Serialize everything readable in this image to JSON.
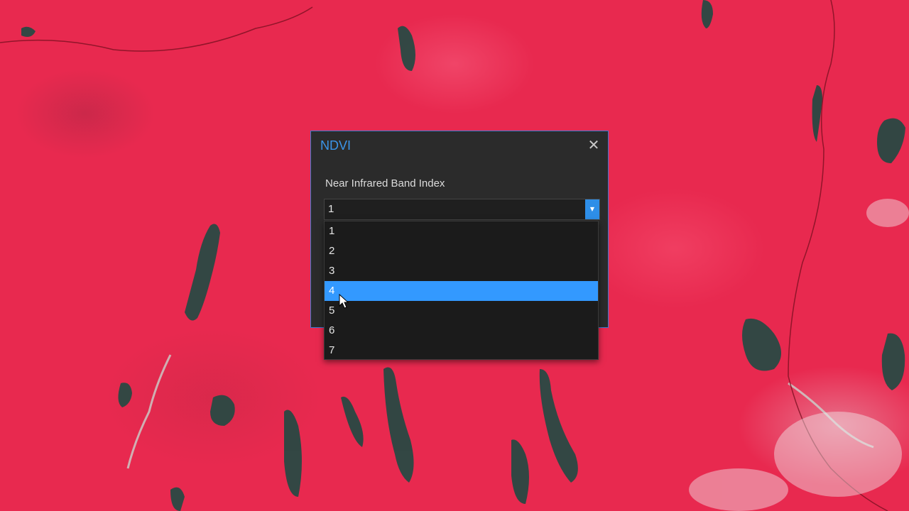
{
  "dialog": {
    "title": "NDVI",
    "close_icon": "close-icon"
  },
  "form": {
    "label": "Near Infrared Band Index",
    "selected_value": "1"
  },
  "dropdown": {
    "options": [
      "1",
      "2",
      "3",
      "4",
      "5",
      "6",
      "7"
    ],
    "highlighted_option": "4"
  },
  "colors": {
    "accent": "#3399ff",
    "title": "#3b95ea",
    "dialog_bg": "#2b2b2b",
    "map_red": "#e8294f"
  }
}
